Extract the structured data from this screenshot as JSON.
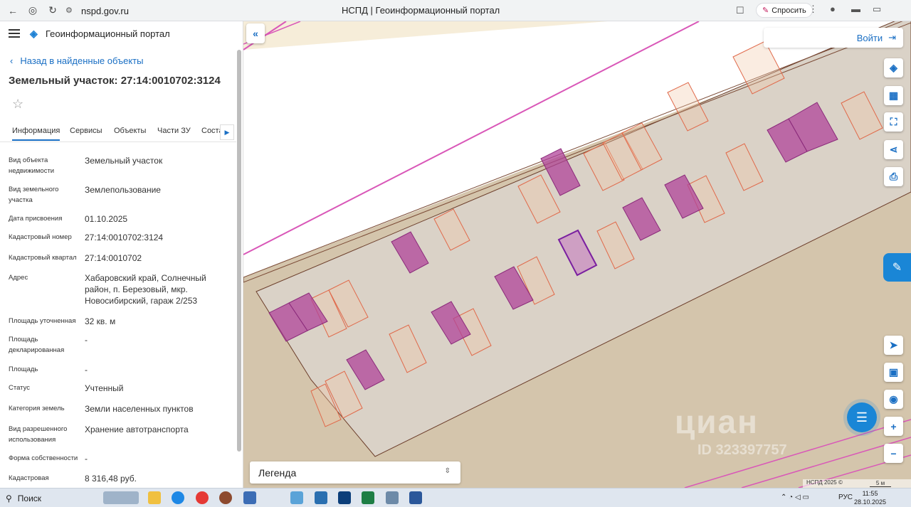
{
  "browser": {
    "url": "nspd.gov.ru",
    "window_title": "НСПД | Геоинформационный портал",
    "ask_label": "Спросить"
  },
  "panel": {
    "portal_title": "Геоинформационный портал",
    "back_label": "Назад в найденные объекты",
    "object_title": "Земельный участок: 27:14:0010702:3124",
    "tabs": [
      "Информация",
      "Сервисы",
      "Объекты",
      "Части ЗУ",
      "Соста"
    ],
    "active_tab": "Информация",
    "rows": [
      {
        "label": "Вид объекта недвижимости",
        "value": "Земельный участок"
      },
      {
        "label": "Вид земельного участка",
        "value": "Землепользование"
      },
      {
        "label": "Дата присвоения",
        "value": "01.10.2025"
      },
      {
        "label": "Кадастровый номер",
        "value": "27:14:0010702:3124"
      },
      {
        "label": "Кадастровый квартал",
        "value": "27:14:0010702"
      },
      {
        "label": "Адрес",
        "value": "Хабаровский край, Солнечный район, п. Березовый, мкр. Новосибирский, гараж 2/253"
      },
      {
        "label": "Площадь уточненная",
        "value": "32 кв. м"
      },
      {
        "label": "Площадь декларированная",
        "value": "-"
      },
      {
        "label": "Площадь",
        "value": "-"
      },
      {
        "label": "Статус",
        "value": "Учтенный"
      },
      {
        "label": "Категория земель",
        "value": "Земли населенных пунктов"
      },
      {
        "label": "Вид разрешенного использования",
        "value": "Хранение автотранспорта"
      },
      {
        "label": "Форма собственности",
        "value": "-"
      },
      {
        "label": "Кадастровая",
        "value": "8 316,48 руб."
      }
    ]
  },
  "map": {
    "login_label": "Войти",
    "legend_label": "Легенда",
    "copyright": "НСПД 2025 ©",
    "scale_label": "5 м",
    "watermark": "циан",
    "watermark_id": "ID 323397757"
  },
  "taskbar": {
    "search_label": "Поиск",
    "lang": "РУС",
    "time": "11:55",
    "date": "28.10.2025"
  }
}
